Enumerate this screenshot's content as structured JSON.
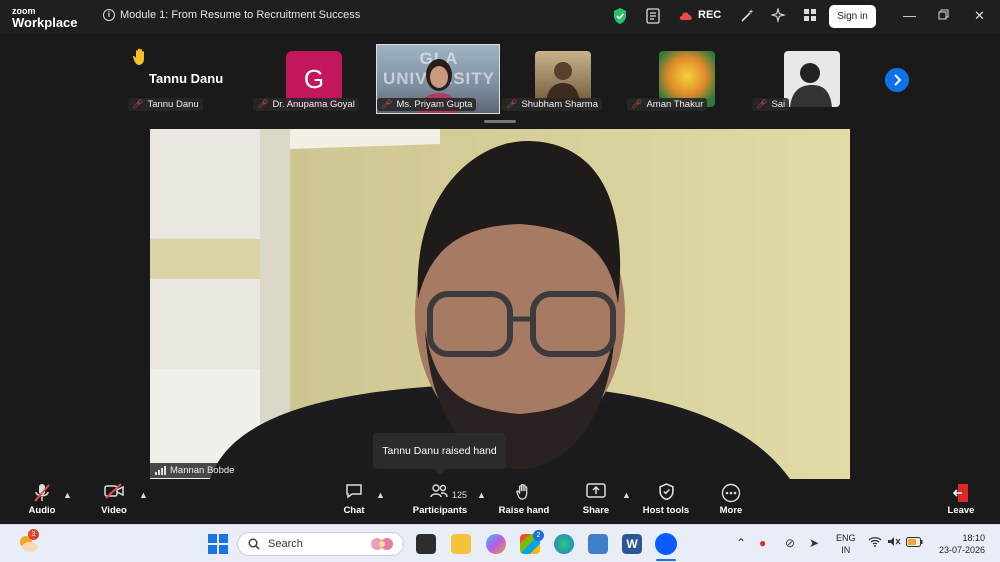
{
  "app": {
    "brand_small": "zoom",
    "brand_large": "Workplace"
  },
  "meeting": {
    "title": "Module 1: From Resume to Recruitment Success"
  },
  "titlebar": {
    "rec_label": "REC",
    "signin_label": "Sign in"
  },
  "gallery": {
    "raised_hand_name": "Tannu Danu",
    "participants": [
      {
        "name": "Tannu Danu"
      },
      {
        "name": "Dr. Anupama Goyal",
        "initial": "G"
      },
      {
        "name": "Ms. Priyam Gupta"
      },
      {
        "name": "Shubham Sharma"
      },
      {
        "name": "Aman Thakur"
      },
      {
        "name": "Sai"
      }
    ],
    "video_banner_text": "GLA UNIVERSITY"
  },
  "main": {
    "speaker_name": "Mannan Bobde",
    "tooltip": "Tannu Danu raised hand"
  },
  "toolbar": {
    "audio": "Audio",
    "video": "Video",
    "chat": "Chat",
    "participants": "Participants",
    "participant_count": "125",
    "raise_hand": "Raise hand",
    "share": "Share",
    "host_tools": "Host tools",
    "more": "More",
    "leave": "Leave"
  },
  "taskbar": {
    "search_placeholder": "Search",
    "weather_badge": "3",
    "store_badge": "2",
    "lang_line1": "ENG",
    "lang_line2": "IN",
    "time": "18:10",
    "date": "23-07-2026"
  },
  "colors": {
    "accent": "#0e72ed",
    "avatar_g": "#c2185b",
    "mic_off": "#e84b4b",
    "leave": "#e02828"
  }
}
